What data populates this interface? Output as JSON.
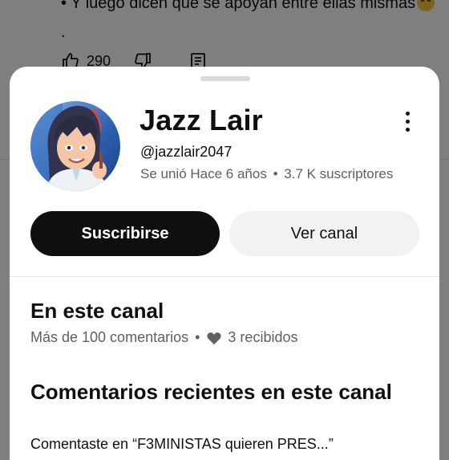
{
  "background": {
    "comment_text": "• Y luego dicen que se apoyan entre ellas mismas",
    "comment_tail": ".",
    "likes_count": "290"
  },
  "sheet": {
    "channel_name": "Jazz Lair",
    "channel_handle": "@jazzlair2047",
    "joined": "Se unió Hace 6 años",
    "separator": "•",
    "subscribers": "3.7 K suscriptores",
    "subscribe_label": "Suscribirse",
    "view_channel_label": "Ver canal",
    "on_channel_title": "En este canal",
    "comments_count": "Más de 100 comentarios",
    "hearts_received": "3 recibidos",
    "recent_comments_title": "Comentarios recientes en este canal",
    "recent_comment_preview": "Comentaste en “F3MINISTAS quieren PRES...”"
  },
  "colors": {
    "scrim": "#7f7f7f",
    "subscribe_bg": "#0f0f0f",
    "secondary_btn_bg": "#f2f2f2",
    "muted_text": "#606060"
  },
  "icons": [
    "like-icon",
    "dislike-icon",
    "reply-icon",
    "more-vert-icon",
    "heart-icon",
    "sad-face-emoji-icon"
  ]
}
